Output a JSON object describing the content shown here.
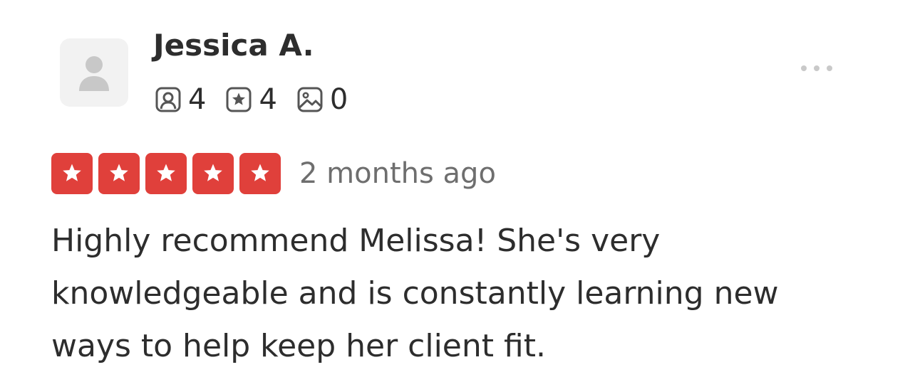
{
  "reviewer": {
    "name": "Jessica A.",
    "avatar_icon": "default-user-avatar-icon"
  },
  "stats": {
    "friends": {
      "icon": "friends-icon",
      "value": "4"
    },
    "reviews": {
      "icon": "reviews-star-icon",
      "value": "4"
    },
    "photos": {
      "icon": "photos-icon",
      "value": "0"
    }
  },
  "menu": {
    "icon": "more-options-icon"
  },
  "rating": {
    "stars": 5,
    "max_stars": 5,
    "star_color": "#e0403b",
    "date": "2 months ago"
  },
  "review": {
    "text": "Highly recommend Melissa! She's very knowledgeable and is constantly learning new ways to help keep her client fit."
  }
}
